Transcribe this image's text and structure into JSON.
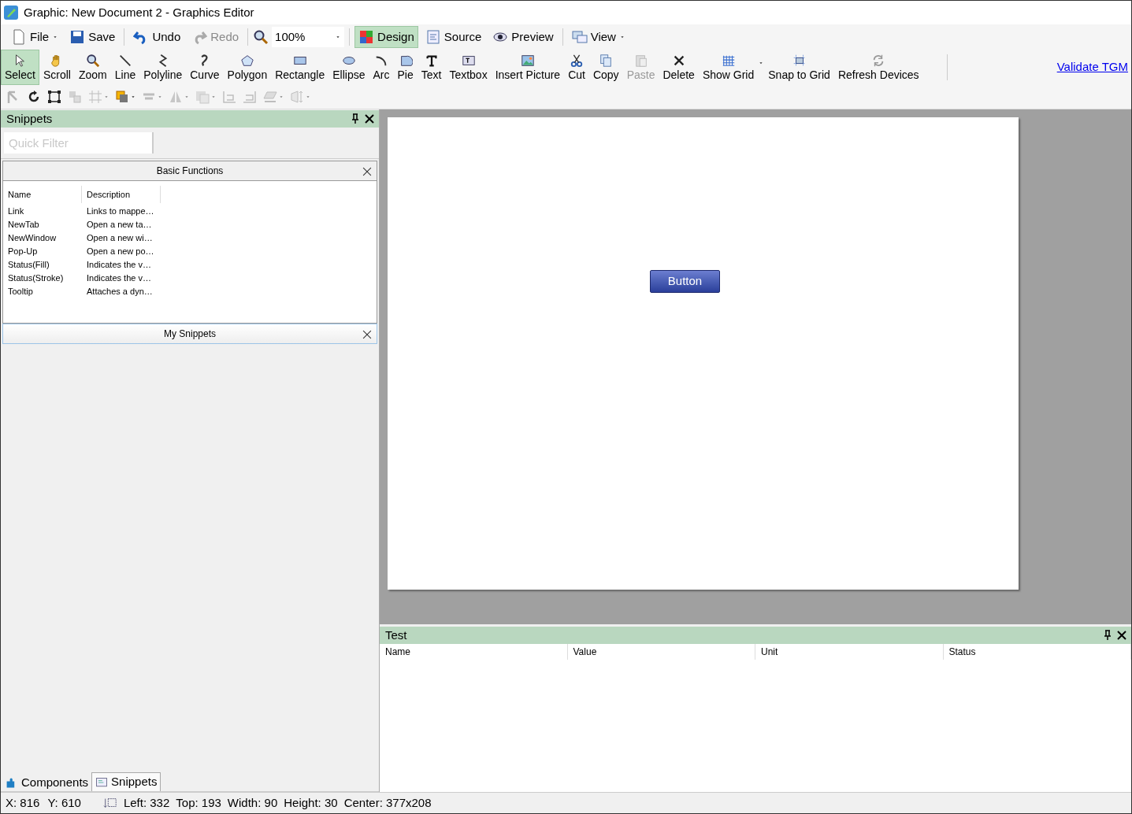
{
  "window": {
    "title": "Graphic: New Document 2 - Graphics Editor"
  },
  "main_toolbar": [
    {
      "kind": "dropdown",
      "label": "File",
      "disabled": false
    },
    {
      "kind": "button",
      "label": "Save",
      "disabled": false
    },
    {
      "kind": "separator"
    },
    {
      "kind": "button",
      "label": "Undo",
      "disabled": false
    },
    {
      "kind": "button",
      "label": "Redo",
      "disabled": true
    },
    {
      "kind": "separator"
    },
    {
      "kind": "combo",
      "value": "100%"
    },
    {
      "kind": "separator"
    },
    {
      "kind": "mode",
      "label": "Design",
      "selected": true
    },
    {
      "kind": "mode",
      "label": "Source",
      "selected": false
    },
    {
      "kind": "mode",
      "label": "Preview",
      "selected": false
    },
    {
      "kind": "separator"
    },
    {
      "kind": "dropdown",
      "label": "View",
      "disabled": false
    }
  ],
  "tools": [
    {
      "label": "Select",
      "selected": true,
      "disabled": false
    },
    {
      "label": "Scroll",
      "selected": false,
      "disabled": false
    },
    {
      "label": "Zoom",
      "selected": false,
      "disabled": false
    },
    {
      "label": "Line",
      "selected": false,
      "disabled": false
    },
    {
      "label": "Polyline",
      "selected": false,
      "disabled": false
    },
    {
      "label": "Curve",
      "selected": false,
      "disabled": false
    },
    {
      "label": "Polygon",
      "selected": false,
      "disabled": false
    },
    {
      "label": "Rectangle",
      "selected": false,
      "disabled": false
    },
    {
      "label": "Ellipse",
      "selected": false,
      "disabled": false
    },
    {
      "label": "Arc",
      "selected": false,
      "disabled": false
    },
    {
      "label": "Pie",
      "selected": false,
      "disabled": false
    },
    {
      "label": "Text",
      "selected": false,
      "disabled": false
    },
    {
      "label": "Textbox",
      "selected": false,
      "disabled": false
    },
    {
      "label": "Insert Picture",
      "selected": false,
      "disabled": false
    },
    {
      "label": "Cut",
      "selected": false,
      "disabled": false
    },
    {
      "label": "Copy",
      "selected": false,
      "disabled": false
    },
    {
      "label": "Paste",
      "selected": false,
      "disabled": true
    },
    {
      "label": "Delete",
      "selected": false,
      "disabled": false
    },
    {
      "label": "Show Grid",
      "selected": false,
      "disabled": false,
      "dropdown": true
    },
    {
      "label": "Snap to Grid",
      "selected": false,
      "disabled": false
    },
    {
      "label": "Refresh Devices",
      "selected": false,
      "disabled": false
    }
  ],
  "validate_link": "Validate TGM",
  "arrange_tools": [
    {
      "disabled": true,
      "dropdown": false
    },
    {
      "disabled": false,
      "dropdown": false
    },
    {
      "disabled": false,
      "dropdown": false
    },
    {
      "disabled": true,
      "dropdown": false
    },
    {
      "disabled": true,
      "dropdown": true
    },
    {
      "disabled": false,
      "dropdown": true
    },
    {
      "disabled": true,
      "dropdown": true
    },
    {
      "disabled": true,
      "dropdown": true
    },
    {
      "disabled": true,
      "dropdown": true
    },
    {
      "disabled": true,
      "dropdown": false
    },
    {
      "disabled": true,
      "dropdown": false
    },
    {
      "disabled": true,
      "dropdown": true
    },
    {
      "disabled": true,
      "dropdown": true
    }
  ],
  "snippets_panel": {
    "title": "Snippets",
    "filter": {
      "placeholder": "Quick Filter"
    },
    "groups": [
      {
        "title": "Basic Functions",
        "expanded": true,
        "columns": [
          "Name",
          "Description"
        ],
        "rows": [
          [
            "Link",
            "Links to mappe…"
          ],
          [
            "NewTab",
            "Open a new ta…"
          ],
          [
            "NewWindow",
            "Open a new wi…"
          ],
          [
            "Pop-Up",
            "Open a new po…"
          ],
          [
            "Status(Fill)",
            "Indicates the v…"
          ],
          [
            "Status(Stroke)",
            "Indicates the v…"
          ],
          [
            "Tooltip",
            "Attaches a dyn…"
          ]
        ]
      },
      {
        "title": "My Snippets",
        "expanded": false
      }
    ]
  },
  "bottom_tabs": [
    {
      "label": "Components",
      "selected": false
    },
    {
      "label": "Snippets",
      "selected": true
    }
  ],
  "canvas": {
    "button_label": "Button"
  },
  "test_panel": {
    "title": "Test",
    "columns": [
      "Name",
      "Value",
      "Unit",
      "Status"
    ]
  },
  "status_bar": {
    "x": "X: 816",
    "y": "Y: 610",
    "fields": [
      "Left: 332",
      "Top: 193",
      "Width: 90",
      "Height: 30",
      "Center: 377x208"
    ]
  }
}
